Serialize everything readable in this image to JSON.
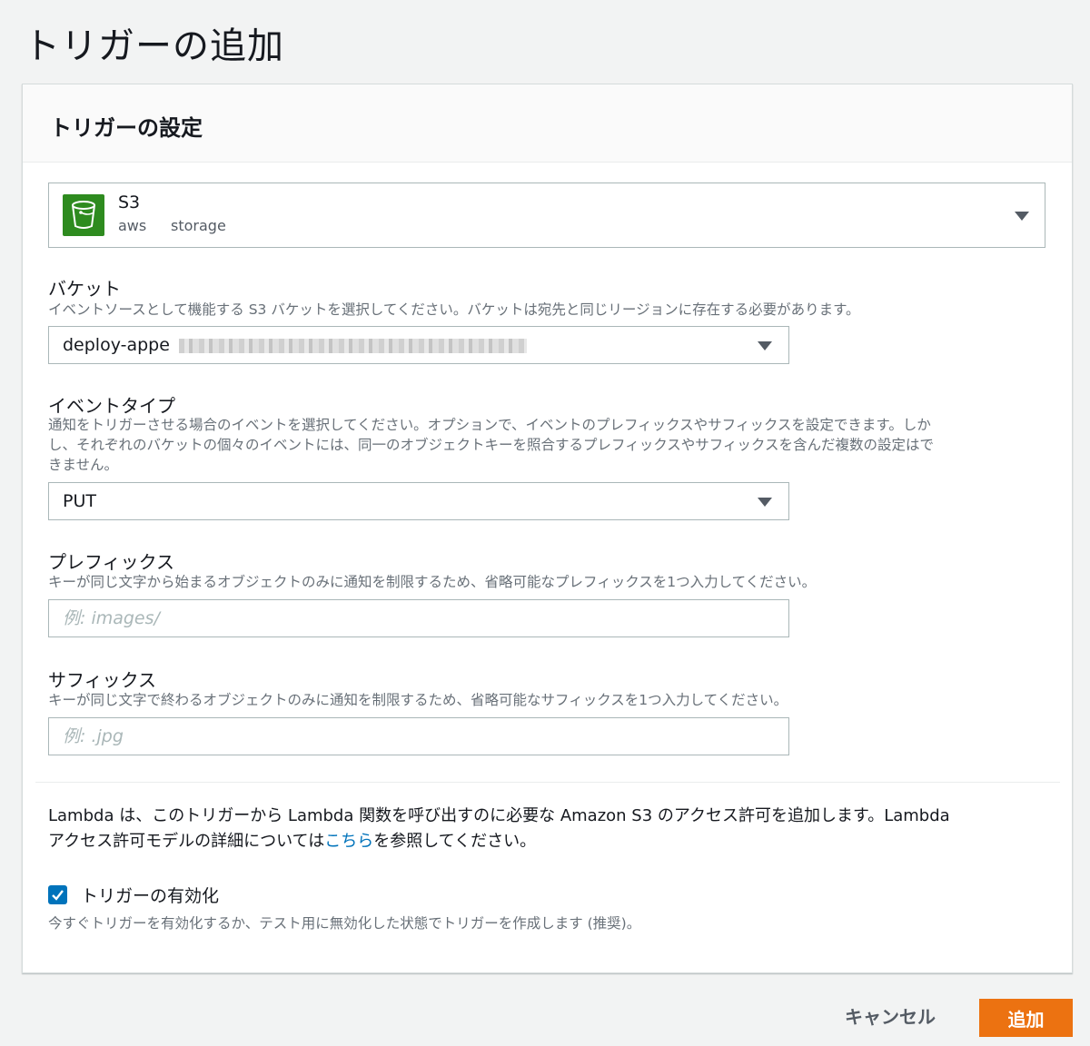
{
  "page": {
    "title": "トリガーの追加"
  },
  "panel": {
    "title": "トリガーの設定",
    "service": {
      "name": "S3",
      "tag1": "aws",
      "tag2": "storage",
      "icon": "s3-bucket-icon"
    },
    "bucket": {
      "label": "バケット",
      "description": "イベントソースとして機能する S3 バケットを選択してください。バケットは宛先と同じリージョンに存在する必要があります。",
      "value": "deploy-appe"
    },
    "event_type": {
      "label": "イベントタイプ",
      "description_line1": "通知をトリガーさせる場合のイベントを選択してください。オプションで、イベントのプレフィックスやサフィックスを設定できます。しか",
      "description_line2": "し、それぞれのバケットの個々のイベントには、同一のオブジェクトキーを照合するプレフィックスやサフィックスを含んだ複数の設定はで",
      "description_line3": "きません。",
      "value": "PUT"
    },
    "prefix": {
      "label": "プレフィックス",
      "description": "キーが同じ文字から始まるオブジェクトのみに通知を制限するため、省略可能なプレフィックスを1つ入力してください。",
      "placeholder": "例: images/"
    },
    "suffix": {
      "label": "サフィックス",
      "description": "キーが同じ文字で終わるオブジェクトのみに通知を制限するため、省略可能なサフィックスを1つ入力してください。",
      "placeholder": "例: .jpg"
    },
    "permission_info": {
      "line1": "Lambda は、このトリガーから Lambda 関数を呼び出すのに必要な Amazon S3 のアクセス許可を追加します。Lambda",
      "line2_before": "アクセス許可モデルの詳細については",
      "link": "こちら",
      "line2_after": "を参照してください。"
    },
    "enable_trigger": {
      "label": "トリガーの有効化",
      "checked": true,
      "description": "今すぐトリガーを有効化するか、テスト用に無効化した状態でトリガーを作成します (推奨)。"
    }
  },
  "footer": {
    "cancel_label": "キャンセル",
    "add_label": "追加"
  },
  "colors": {
    "accent": "#ec7211",
    "link": "#0073bb",
    "s3_green": "#2e8b1f"
  }
}
